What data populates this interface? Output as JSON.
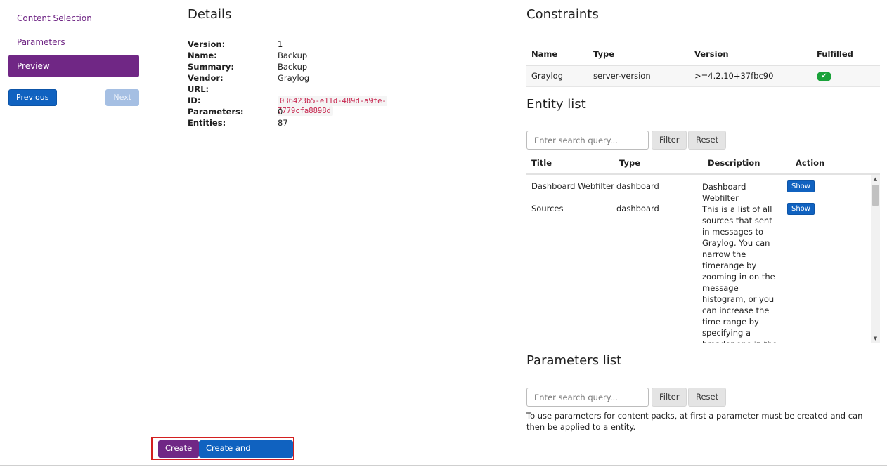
{
  "wizard": {
    "steps": [
      {
        "label": "Content Selection"
      },
      {
        "label": "Parameters"
      },
      {
        "label": "Preview"
      }
    ],
    "active_step": "Preview",
    "previous_label": "Previous",
    "next_label": "Next"
  },
  "details": {
    "title": "Details",
    "rows": [
      {
        "label": "Version:",
        "value": "1"
      },
      {
        "label": "Name:",
        "value": "Backup"
      },
      {
        "label": "Summary:",
        "value": "Backup"
      },
      {
        "label": "Vendor:",
        "value": "Graylog"
      },
      {
        "label": "URL:",
        "value": ""
      },
      {
        "label": "ID:",
        "value": "036423b5-e11d-489d-a9fe-7779cfa8898d"
      },
      {
        "label": "Parameters:",
        "value": "0"
      },
      {
        "label": "Entities:",
        "value": "87"
      }
    ]
  },
  "constraints": {
    "title": "Constraints",
    "headers": [
      "Name",
      "Type",
      "Version",
      "Fulfilled"
    ],
    "rows": [
      {
        "name": "Graylog",
        "type": "server-version",
        "version": ">=4.2.10+37fbc90",
        "fulfilled": "check-icon"
      }
    ]
  },
  "entity_list": {
    "title": "Entity list",
    "search_placeholder": "Enter search query...",
    "filter_label": "Filter",
    "reset_label": "Reset",
    "headers": [
      "Title",
      "Type",
      "Description",
      "Action"
    ],
    "rows": [
      {
        "title": "Dashboard Webfilter",
        "type": "dashboard",
        "description": "Dashboard Webfilter",
        "action": "Show"
      },
      {
        "title": "Sources",
        "type": "dashboard",
        "description": "This is a list of all sources that sent in messages to Graylog. You can narrow the timerange by zooming in on the message histogram, or you can increase the time range by specifying a broader one in the controls at the top. You can",
        "action": "Show"
      }
    ]
  },
  "parameters_list": {
    "title": "Parameters list",
    "search_placeholder": "Enter search query...",
    "filter_label": "Filter",
    "reset_label": "Reset",
    "help_text": "To use parameters for content packs, at first a parameter must be created and can then be applied to a entity."
  },
  "actions": {
    "create_label": "Create",
    "create_download_label": "Create and Download"
  },
  "colors": {
    "brand_purple": "#702785",
    "primary_blue": "#1062c0",
    "success_green": "#1aa23a",
    "highlight_red": "#d32020"
  }
}
